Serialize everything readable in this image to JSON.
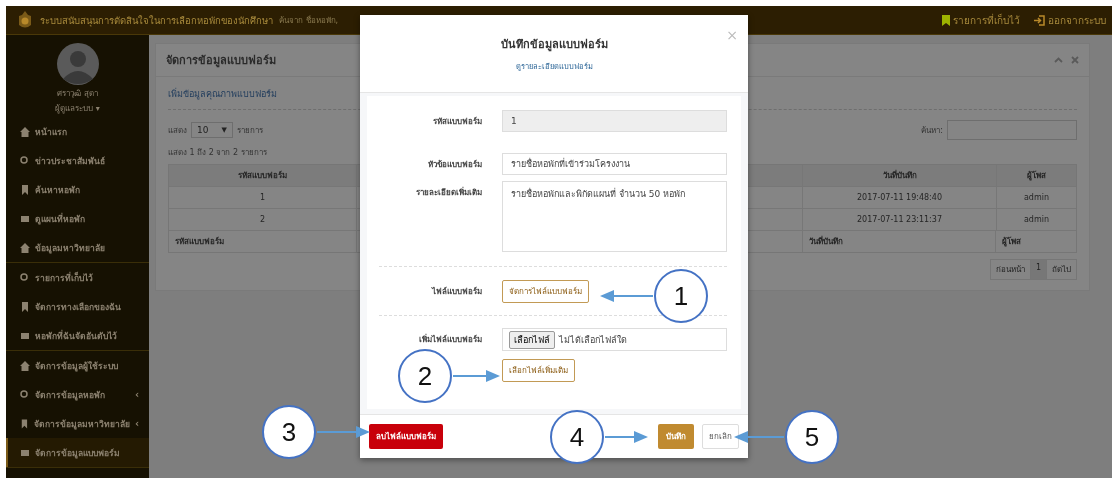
{
  "header": {
    "title": "ระบบสนับสนุนการตัดสินใจในการเลือกหอพักของนักศึกษา",
    "search_hint": "ค้นจาก ชื่อหอพัก,",
    "links": [
      "รายการที่เก็บไว้",
      "ออกจากระบบ"
    ]
  },
  "user": {
    "name": "ศราวุฒิ สุดา",
    "role": "ผู้ดูแลระบบ",
    "caret": "▾"
  },
  "sidebar": {
    "groups": [
      [
        {
          "label": "หน้าแรก",
          "selected": false
        },
        {
          "label": "ข่าวประชาสัมพันธ์",
          "selected": false
        },
        {
          "label": "ค้นหาหอพัก",
          "selected": false
        },
        {
          "label": "ดูแผนที่หอพัก",
          "selected": false
        },
        {
          "label": "ข้อมูลมหาวิทยาลัย",
          "selected": false
        }
      ],
      [
        {
          "label": "รายการที่เก็บไว้",
          "selected": false
        },
        {
          "label": "จัดการทางเลือกของฉัน",
          "selected": false
        },
        {
          "label": "หอพักที่ฉันจัดอันดับไว้",
          "selected": false
        }
      ],
      [
        {
          "label": "จัดการข้อมูลผู้ใช้ระบบ",
          "selected": false
        },
        {
          "label": "จัดการข้อมูลหอพัก",
          "chevron": "‹",
          "selected": false
        },
        {
          "label": "จัดการข้อมูลมหาวิทยาลัย",
          "chevron": "‹",
          "selected": false
        },
        {
          "label": "จัดการข้อมูลแบบฟอร์ม",
          "selected": true
        }
      ]
    ]
  },
  "panel": {
    "title": "จัดการข้อมูลแบบฟอร์ม",
    "add_link": "เพิ่มข้อมูลคุณภาพแบบฟอร์ม",
    "length_label": "แสดง",
    "length_value": "10",
    "length_caret": "▼",
    "length_unit": "รายการ",
    "info": "แสดง 1 ถึง 2 จาก 2 รายการ",
    "search_label": "ค้นหา:",
    "table": {
      "columns": [
        "รหัสแบบฟอร์ม",
        "วันที่บันทึก",
        "ผู้โพส"
      ],
      "rows": [
        [
          "1",
          "2017-07-11 19:48:40",
          "admin"
        ],
        [
          "2",
          "2017-07-11 23:11:37",
          "admin"
        ]
      ],
      "footer": [
        "รหัสแบบฟอร์ม",
        "วันที่บันทึก",
        "ผู้โพส"
      ]
    },
    "pagination": [
      {
        "label": "ก่อนหน้า",
        "selected": false
      },
      {
        "label": "1",
        "selected": true
      },
      {
        "label": "ถัดไป",
        "selected": false
      }
    ]
  },
  "modal": {
    "title": "บันทึกข้อมูลแบบฟอร์ม",
    "link": "ดูรายละเอียดแบบฟอร์ม",
    "close": "×",
    "fields": [
      {
        "kind": "readonly",
        "label": "รหัสแบบฟอร์ม",
        "value": "1"
      },
      {
        "kind": "text",
        "label": "หัวข้อแบบฟอร์ม",
        "value": "รายชื่อหอพักที่เข้าร่วมโครงงาน"
      },
      {
        "kind": "textarea",
        "label": "รายละเอียดเพิ่มเติม",
        "value": "รายชื่อหอพักและพิกัดแผนที่ จำนวน 50 หอพัก"
      },
      {
        "kind": "button",
        "label": "ไฟล์แบบฟอร์ม",
        "button": "จัดการไฟล์แบบฟอร์ม"
      },
      {
        "kind": "file",
        "label": "เพิ่มไฟล์แบบฟอร์ม",
        "file_button": "เลือกไฟล์",
        "file_status": "ไม่ได้เลือกไฟล์ใด",
        "extra_button": "เลือกไฟล์เพิ่มเติม"
      }
    ],
    "footer": {
      "delete": "ลบไฟล์แบบฟอร์ม",
      "save": "บันทึก",
      "cancel": "ยกเลิก"
    }
  },
  "callouts": [
    "1",
    "2",
    "3",
    "4",
    "5"
  ]
}
